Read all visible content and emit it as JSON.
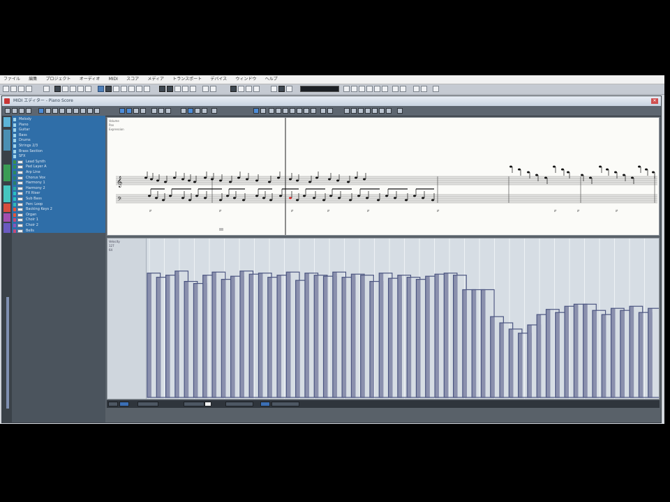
{
  "window": {
    "title": "MIDI エディター - Piano Score"
  },
  "menu": [
    "ファイル",
    "編集",
    "プロジェクト",
    "オーディオ",
    "MIDI",
    "スコア",
    "メディア",
    "トランスポート",
    "デバイス",
    "ウィンドウ",
    "ヘルプ"
  ],
  "tracks": [
    {
      "label": "Melody",
      "color": "#9fd3ea"
    },
    {
      "label": "Piano",
      "color": "#9fd3ea"
    },
    {
      "label": "Guitar",
      "color": "#9fd3ea"
    },
    {
      "label": "Bass",
      "color": "#9fd3ea"
    },
    {
      "label": "Drums",
      "color": "#9fd3ea"
    },
    {
      "label": "Strings 2/3",
      "color": "#9fd3ea"
    },
    {
      "label": "Brass Section",
      "color": "#9fd3ea"
    },
    {
      "label": "SFX",
      "color": "#9fd3ea"
    },
    {
      "label": "Lead Synth",
      "color": "#3b8f4a"
    },
    {
      "label": "Pad Layer A",
      "color": "#2f8f55"
    },
    {
      "label": "Arp Line",
      "color": "#2b8860"
    },
    {
      "label": "Chorus Vox",
      "color": "#2a7f6b"
    },
    {
      "label": "Harmony 1",
      "color": "#2a7f6b"
    },
    {
      "label": "Harmony 2",
      "color": "#28a7a0"
    },
    {
      "label": "FX Riser",
      "color": "#28c0c0"
    },
    {
      "label": "Sub Bass",
      "color": "#28c0c0"
    },
    {
      "label": "Perc Loop",
      "color": "#2fb9b5"
    },
    {
      "label": "Backing Keys 2",
      "color": "#e0573a"
    },
    {
      "label": "Organ",
      "color": "#e0573a"
    },
    {
      "label": "Choir 1",
      "color": "#c24a7a"
    },
    {
      "label": "Choir 2",
      "color": "#8a56b8"
    },
    {
      "label": "Bells",
      "color": "#c24a7a"
    }
  ],
  "colors": {
    "accent": "#2f6ea8",
    "velocity_bar": "#8a90ad",
    "velocity_outline": "#4b5580",
    "playhead": "#444444",
    "score_bg": "#fbfbf8"
  },
  "score_info_labels": [
    "Volume",
    "Pan",
    "Expression"
  ],
  "velocity_info_labels": [
    "Velocity",
    "127",
    "64"
  ],
  "toolbar_icons": [
    "select-icon",
    "pencil-icon",
    "eraser-icon",
    "zoom-icon",
    "mute-icon",
    "glue-icon",
    "split-icon",
    "play-icon",
    "stop-icon",
    "record-icon",
    "loop-icon",
    "metronome-icon",
    "quantize-icon",
    "snap-icon"
  ],
  "velocity_data": {
    "note_velocities": [
      120,
      116,
      118,
      122,
      112,
      110,
      118,
      121,
      114,
      117,
      122,
      119,
      120,
      116,
      118,
      121,
      113,
      120,
      118,
      117,
      121,
      116,
      119,
      118,
      112,
      120,
      115,
      118,
      116,
      114,
      117,
      119,
      120,
      118,
      104,
      104,
      104,
      78,
      72,
      66,
      62,
      70,
      80,
      85,
      82,
      88,
      90,
      90,
      84,
      80,
      86,
      84,
      88,
      82,
      86
    ]
  }
}
